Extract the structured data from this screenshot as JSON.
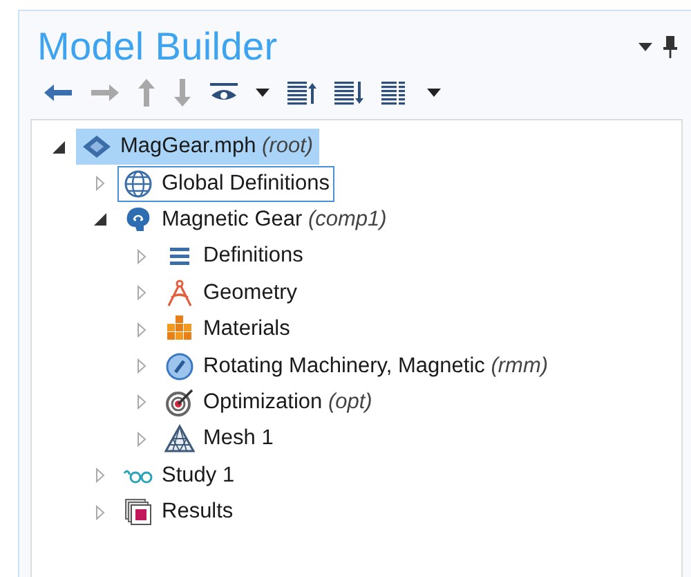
{
  "panel": {
    "title": "Model Builder"
  },
  "toolbar": [
    {
      "kind": "back",
      "disabled": false
    },
    {
      "kind": "forward",
      "disabled": true
    },
    {
      "kind": "up",
      "disabled": true
    },
    {
      "kind": "down",
      "disabled": true
    },
    {
      "kind": "show",
      "disabled": false
    },
    {
      "kind": "caret",
      "disabled": false
    },
    {
      "kind": "collapse",
      "disabled": false
    },
    {
      "kind": "expand",
      "disabled": false
    },
    {
      "kind": "list",
      "disabled": false
    },
    {
      "kind": "caret",
      "disabled": false
    }
  ],
  "tree": [
    {
      "label": "MagGear.mph *(root)*",
      "kind": "root",
      "expanded": true,
      "selected": true,
      "focused": false,
      "children": [
        {
          "label": "Global Definitions",
          "kind": "globe",
          "expanded": false,
          "selected": false,
          "focused": true
        },
        {
          "label": "Magnetic Gear *(comp1)*",
          "kind": "component",
          "expanded": true,
          "selected": false,
          "focused": false,
          "children": [
            {
              "label": "Definitions",
              "kind": "definitions",
              "expanded": false,
              "selected": false,
              "focused": false
            },
            {
              "label": "Geometry",
              "kind": "geometry",
              "expanded": false,
              "selected": false,
              "focused": false
            },
            {
              "label": "Materials",
              "kind": "materials",
              "expanded": false,
              "selected": false,
              "focused": false
            },
            {
              "label": "Rotating Machinery, Magnetic *(rmm)*",
              "kind": "physics",
              "expanded": false,
              "selected": false,
              "focused": false
            },
            {
              "label": "Optimization *(opt)*",
              "kind": "optimization",
              "expanded": false,
              "selected": false,
              "focused": false
            },
            {
              "label": "Mesh 1",
              "kind": "mesh",
              "expanded": false,
              "selected": false,
              "focused": false
            }
          ]
        },
        {
          "label": "Study 1",
          "kind": "study",
          "expanded": false,
          "selected": false,
          "focused": false
        },
        {
          "label": "Results",
          "kind": "results",
          "expanded": false,
          "selected": false,
          "focused": false
        }
      ]
    }
  ]
}
